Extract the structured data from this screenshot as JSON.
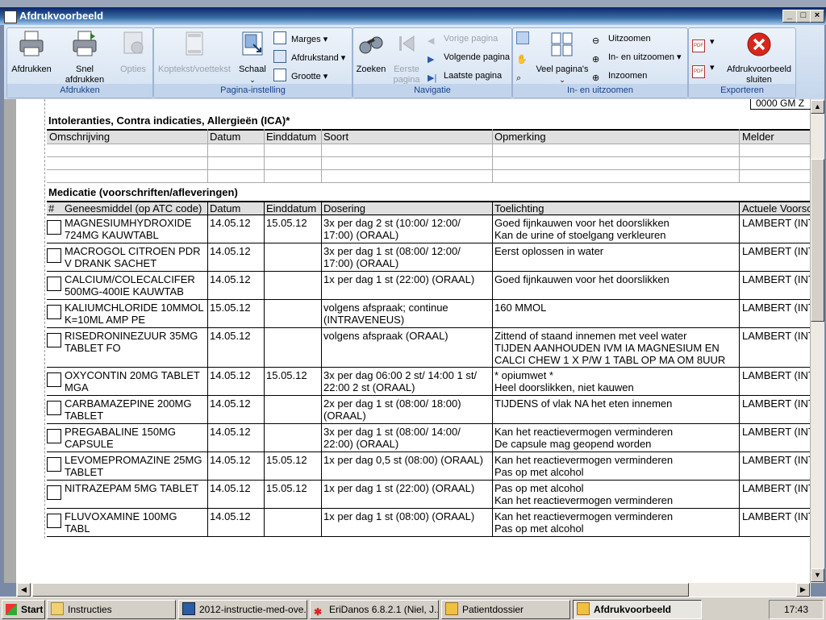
{
  "window": {
    "title": "Afdrukvoorbeeld"
  },
  "ribbon": {
    "groups": {
      "afdrukken": "Afdrukken",
      "pagina_instelling": "Pagina-instelling",
      "navigatie": "Navigatie",
      "zoom": "In- en uitzoomen",
      "exporteren": "Exporteren"
    },
    "buttons": {
      "afdrukken": "Afdrukken",
      "snel_afdrukken": "Snel afdrukken",
      "opties": "Opties",
      "koptekst": "Koptekst/voettekst",
      "schaal": "Schaal",
      "marges": "Marges",
      "afdrukstand": "Afdrukstand",
      "grootte": "Grootte",
      "zoeken": "Zoeken",
      "eerste_pagina_1": "Eerste",
      "eerste_pagina_2": "pagina",
      "vorige_pagina": "Vorige pagina",
      "volgende_pagina": "Volgende pagina",
      "laatste_pagina": "Laatste pagina",
      "veel_paginas": "Veel pagina's",
      "uitzoomen": "Uitzoomen",
      "in_en_uitzoomen": "In- en uitzoomen",
      "inzoomen": "Inzoomen",
      "sluiten_1": "Afdrukvoorbeeld",
      "sluiten_2": "sluiten"
    }
  },
  "document": {
    "corner_text": "0000 GM Z",
    "ica": {
      "title": "Intoleranties, Contra indicaties, Allergieën (ICA)*",
      "headers": [
        "Omschrijving",
        "Datum",
        "Einddatum",
        "Soort",
        "Opmerking",
        "Melder"
      ]
    },
    "medicatie": {
      "title": "Medicatie (voorschriften/afleveringen)",
      "headers": [
        "#",
        "Geneesmiddel (op ATC code)",
        "Datum",
        "Einddatum",
        "Dosering",
        "Toelichting",
        "Actuele Voorsc"
      ],
      "rows": [
        {
          "drug": [
            "MAGNESIUMHYDROXIDE",
            "724MG KAUWTABL"
          ],
          "datum": "14.05.12",
          "einddatum": "15.05.12",
          "dosering": [
            "3x per dag 2 st (10:00/ 12:00/",
            "17:00) (ORAAL)"
          ],
          "toelichting": [
            "Goed fijnkauwen voor het doorslikken",
            "Kan de urine of stoelgang verkleuren"
          ],
          "voorschrijver": "LAMBERT (INT"
        },
        {
          "drug": [
            "MACROGOL CITROEN PDR",
            "V DRANK  SACHET"
          ],
          "datum": "14.05.12",
          "einddatum": "",
          "dosering": [
            "3x per dag 1 st (08:00/ 12:00/",
            "17:00) (ORAAL)"
          ],
          "toelichting": [
            "Eerst oplossen in water"
          ],
          "voorschrijver": "LAMBERT (INT"
        },
        {
          "drug": [
            "CALCIUM/COLECALCIFER",
            "500MG-400IE KAUWTAB"
          ],
          "datum": "14.05.12",
          "einddatum": "",
          "dosering": [
            "1x per dag 1 st (22:00) (ORAAL)"
          ],
          "toelichting": [
            "Goed fijnkauwen voor het doorslikken"
          ],
          "voorschrijver": "LAMBERT (INT"
        },
        {
          "drug": [
            "KALIUMCHLORIDE 10MMOL",
            "K=10ML AMP PE"
          ],
          "datum": "15.05.12",
          "einddatum": "",
          "dosering": [
            "volgens afspraak; continue",
            "(INTRAVENEUS)"
          ],
          "toelichting": [
            "160 MMOL"
          ],
          "voorschrijver": "LAMBERT (INT"
        },
        {
          "drug": [
            "RISEDRONINEZUUR 35MG",
            "TABLET FO"
          ],
          "datum": "14.05.12",
          "einddatum": "",
          "dosering": [
            "volgens afspraak (ORAAL)"
          ],
          "toelichting": [
            "Zittend of staand innemen met veel water",
            "TIJDEN AANHOUDEN IVM IA MAGNESIUM EN",
            "CALCI CHEW 1 X P/W 1 TABL OP MA OM 8UUR"
          ],
          "voorschrijver": "LAMBERT (INT"
        },
        {
          "drug": [
            "OXYCONTIN 20MG TABLET",
            "MGA"
          ],
          "datum": "14.05.12",
          "einddatum": "15.05.12",
          "dosering": [
            "3x per dag 06:00 2 st/ 14:00 1 st/",
            "22:00 2 st (ORAAL)"
          ],
          "toelichting": [
            "* opiumwet *",
            "Heel doorslikken, niet kauwen"
          ],
          "voorschrijver": "LAMBERT (INT"
        },
        {
          "drug": [
            "CARBAMAZEPINE 200MG",
            "TABLET"
          ],
          "datum": "14.05.12",
          "einddatum": "",
          "dosering": [
            "2x per dag 1 st (08:00/ 18:00)",
            "(ORAAL)"
          ],
          "toelichting": [
            "TIJDENS of vlak NA het eten innemen"
          ],
          "voorschrijver": "LAMBERT (INT"
        },
        {
          "drug": [
            "PREGABALINE 150MG",
            "CAPSULE"
          ],
          "datum": "14.05.12",
          "einddatum": "",
          "dosering": [
            "3x per dag 1 st (08:00/ 14:00/",
            "22:00) (ORAAL)"
          ],
          "toelichting": [
            "Kan het reactievermogen verminderen",
            "De capsule mag geopend worden"
          ],
          "voorschrijver": "LAMBERT (INT"
        },
        {
          "drug": [
            "LEVOMEPROMAZINE 25MG",
            "TABLET"
          ],
          "datum": "14.05.12",
          "einddatum": "15.05.12",
          "dosering": [
            "1x per dag 0,5 st (08:00) (ORAAL)"
          ],
          "toelichting": [
            "Kan het reactievermogen verminderen",
            "Pas op met alcohol"
          ],
          "voorschrijver": "LAMBERT (INT"
        },
        {
          "drug": [
            "NITRAZEPAM 5MG TABLET"
          ],
          "datum": "14.05.12",
          "einddatum": "15.05.12",
          "dosering": [
            "1x per dag 1 st (22:00) (ORAAL)"
          ],
          "toelichting": [
            "Pas op met alcohol",
            "Kan het reactievermogen verminderen"
          ],
          "voorschrijver": "LAMBERT (INT"
        },
        {
          "drug": [
            "FLUVOXAMINE 100MG",
            "TABL"
          ],
          "datum": "14.05.12",
          "einddatum": "",
          "dosering": [
            "1x per dag 1 st (08:00) (ORAAL)"
          ],
          "toelichting": [
            "Kan het reactievermogen verminderen",
            "Pas op met alcohol"
          ],
          "voorschrijver": "LAMBERT (INT"
        }
      ]
    }
  },
  "taskbar": {
    "start": "Start",
    "items": [
      "Instructies",
      "2012-instructie-med-ove...",
      "EriDanos 6.8.2.1 (Niel, J...",
      "Patientdossier",
      "Afdrukvoorbeeld"
    ],
    "clock": "17:43"
  },
  "colors": {
    "title_bar": "#0a246a",
    "ribbon_label": "#15428b",
    "close_red": "#d9261c"
  }
}
